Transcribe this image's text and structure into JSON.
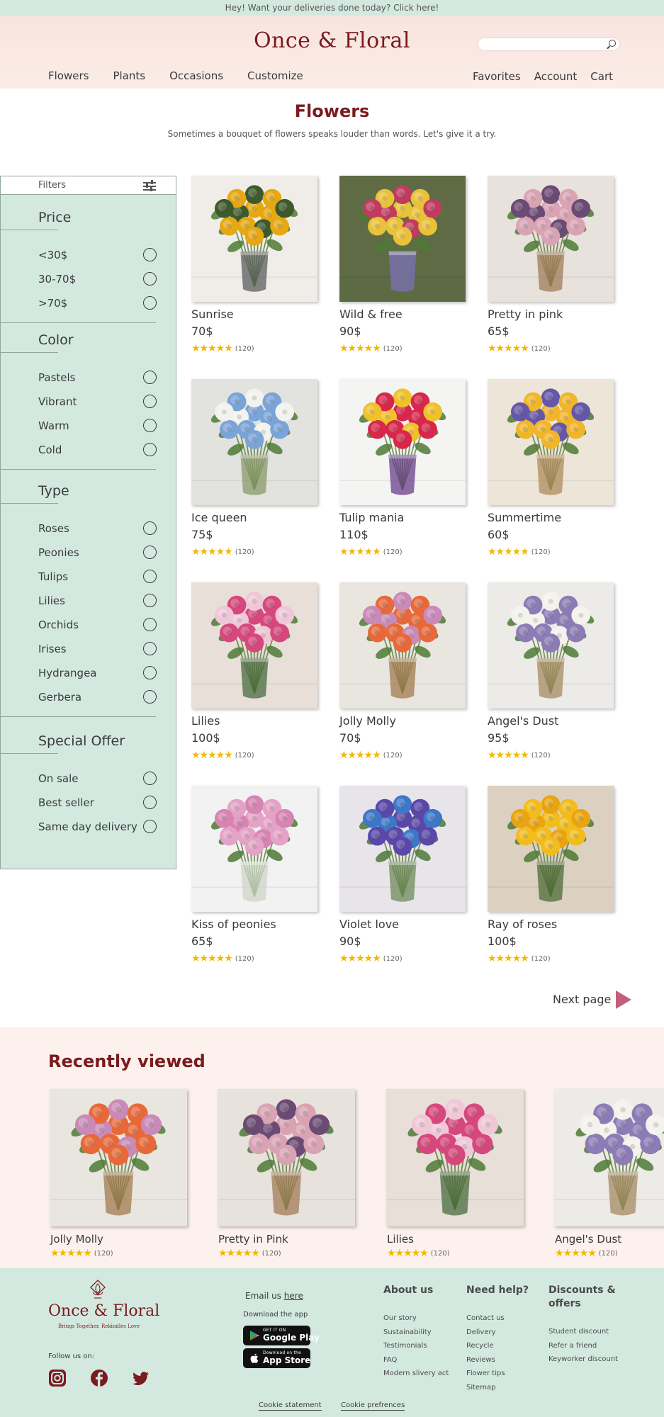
{
  "banner": {
    "text": "Hey! Want your deliveries done today? Click here!"
  },
  "header": {
    "logo": "Once & Floral",
    "nav_left": [
      "Flowers",
      "Plants",
      "Occasions",
      "Customize"
    ],
    "nav_right": [
      "Favorites",
      "Account",
      "Cart"
    ],
    "search": {
      "placeholder": ""
    }
  },
  "page": {
    "title": "Flowers",
    "subtitle": "Sometimes a bouquet of flowers speaks louder than words. Let's give it a try."
  },
  "filters": {
    "label": "Filters",
    "sections": [
      {
        "title": "Price",
        "options": [
          "<30$",
          "30-70$",
          ">70$"
        ]
      },
      {
        "title": "Color",
        "options": [
          "Pastels",
          "Vibrant",
          "Warm",
          "Cold"
        ]
      },
      {
        "title": "Type",
        "options": [
          "Roses",
          "Peonies",
          "Tulips",
          "Lilies",
          "Orchids",
          "Irises",
          "Hydrangea",
          "Gerbera"
        ]
      },
      {
        "title": "Special Offer",
        "options": [
          "On sale",
          "Best seller",
          "Same day delivery"
        ]
      }
    ]
  },
  "products": [
    {
      "name": "Sunrise",
      "price": "70$",
      "rating": 5,
      "reviews": "(120)",
      "image": "sunflower-bouquet",
      "palette": [
        "#f0ede8",
        "#e5a813",
        "#3d5a2b",
        "#5a5e5d"
      ]
    },
    {
      "name": "Wild & free",
      "price": "90$",
      "rating": 5,
      "reviews": "(120)",
      "image": "mixed-wildflower-bouquet",
      "palette": [
        "#5e6b45",
        "#e9c23a",
        "#c13b5f",
        "#7d6fb8"
      ]
    },
    {
      "name": "Pretty in pink",
      "price": "65$",
      "rating": 5,
      "reviews": "(120)",
      "image": "pink-rose-bouquet",
      "palette": [
        "#e8e2dc",
        "#d9a3b4",
        "#6b4a73",
        "#a17b56"
      ]
    },
    {
      "name": "Ice queen",
      "price": "75$",
      "rating": 5,
      "reviews": "(120)",
      "image": "blue-hydrangea-bouquet",
      "palette": [
        "#e2e3df",
        "#7aa3d8",
        "#f2f2ee",
        "#8a9a6a"
      ]
    },
    {
      "name": "Tulip mania",
      "price": "110$",
      "rating": 5,
      "reviews": "(120)",
      "image": "tulip-bouquet",
      "palette": [
        "#f4f4f2",
        "#d8274a",
        "#f1c12a",
        "#6a3f8a"
      ]
    },
    {
      "name": "Summertime",
      "price": "60$",
      "rating": 5,
      "reviews": "(120)",
      "image": "yellow-iris-bouquet",
      "palette": [
        "#ece5d8",
        "#f1b52a",
        "#6557a8",
        "#b08b5e"
      ]
    },
    {
      "name": "Lilies",
      "price": "100$",
      "rating": 5,
      "reviews": "(120)",
      "image": "pink-lily-bouquet",
      "palette": [
        "#e7dfd8",
        "#d6487b",
        "#f0c7d6",
        "#4a6b3d"
      ]
    },
    {
      "name": "Jolly Molly",
      "price": "70$",
      "rating": 5,
      "reviews": "(120)",
      "image": "orange-rose-mixed-bouquet",
      "palette": [
        "#e9e6df",
        "#e7693a",
        "#c98ab8",
        "#a27a50"
      ]
    },
    {
      "name": "Angel's Dust",
      "price": "95$",
      "rating": 5,
      "reviews": "(120)",
      "image": "purple-white-bouquet",
      "palette": [
        "#ecebe7",
        "#8c7cb5",
        "#f4f2ec",
        "#a68a62"
      ]
    },
    {
      "name": "Kiss of peonies",
      "price": "65$",
      "rating": 5,
      "reviews": "(120)",
      "image": "pink-peony-bouquet",
      "palette": [
        "#f2f2f2",
        "#e4a2c6",
        "#d784b3",
        "#cfd6c8"
      ]
    },
    {
      "name": "Violet love",
      "price": "90$",
      "rating": 5,
      "reviews": "(120)",
      "image": "violet-iris-bouquet",
      "palette": [
        "#e8e5ea",
        "#5a47a8",
        "#3c77c8",
        "#6f8a5a"
      ]
    },
    {
      "name": "Ray of roses",
      "price": "100$",
      "rating": 5,
      "reviews": "(120)",
      "image": "yellow-rose-bouquet",
      "palette": [
        "#dcd1c1",
        "#f2bd1c",
        "#e9a40f",
        "#4d6b38"
      ]
    }
  ],
  "pagination": {
    "next_label": "Next page"
  },
  "recently_viewed": {
    "title": "Recently viewed",
    "items": [
      {
        "name": "Jolly Molly",
        "rating": 5,
        "reviews": "(120)",
        "palette": [
          "#e9e6df",
          "#e7693a",
          "#c98ab8",
          "#a27a50"
        ]
      },
      {
        "name": "Pretty in Pink",
        "rating": 5,
        "reviews": "(120)",
        "palette": [
          "#e8e2dc",
          "#d9a3b4",
          "#6b4a73",
          "#a17b56"
        ]
      },
      {
        "name": "Lilies",
        "rating": 5,
        "reviews": "(120)",
        "palette": [
          "#e7dfd8",
          "#d6487b",
          "#f0c7d6",
          "#4a6b3d"
        ]
      },
      {
        "name": "Angel's Dust",
        "rating": 5,
        "reviews": "(120)",
        "palette": [
          "#ecebe7",
          "#8c7cb5",
          "#f4f2ec",
          "#a68a62"
        ]
      }
    ]
  },
  "footer": {
    "logo": "Once & Floral",
    "tagline": "Brings Together, Rekindles Love",
    "follow_label": "Follow us on:",
    "social": [
      "instagram-icon",
      "facebook-icon",
      "twitter-icon"
    ],
    "email_prefix": "Email us",
    "email_link": "here",
    "download_label": "Download the app",
    "google_play": {
      "small": "GET IT ON",
      "big": "Google Play"
    },
    "app_store": {
      "small": "Download on the",
      "big": "App Store"
    },
    "columns": [
      {
        "title": "About us",
        "links": [
          "Our story",
          "Sustainability",
          "Testimonials",
          "FAQ",
          "Modern slivery act"
        ]
      },
      {
        "title": "Need help?",
        "links": [
          "Contact us",
          "Delivery",
          "Recycle",
          "Reviews",
          "Flower tips",
          "Sitemap"
        ]
      },
      {
        "title": "Discounts & offers",
        "links": [
          "Student discount",
          "Refer a friend",
          "Keyworker discount"
        ]
      }
    ],
    "bottom_links": [
      "Cookie statement",
      "Cookie prefrences"
    ]
  },
  "colors": {
    "brand": "#7b1a1f",
    "mint": "#d3e9e0",
    "blush": "#fcf1ed",
    "star": "#f2b705",
    "arrow": "#c25f7d"
  }
}
